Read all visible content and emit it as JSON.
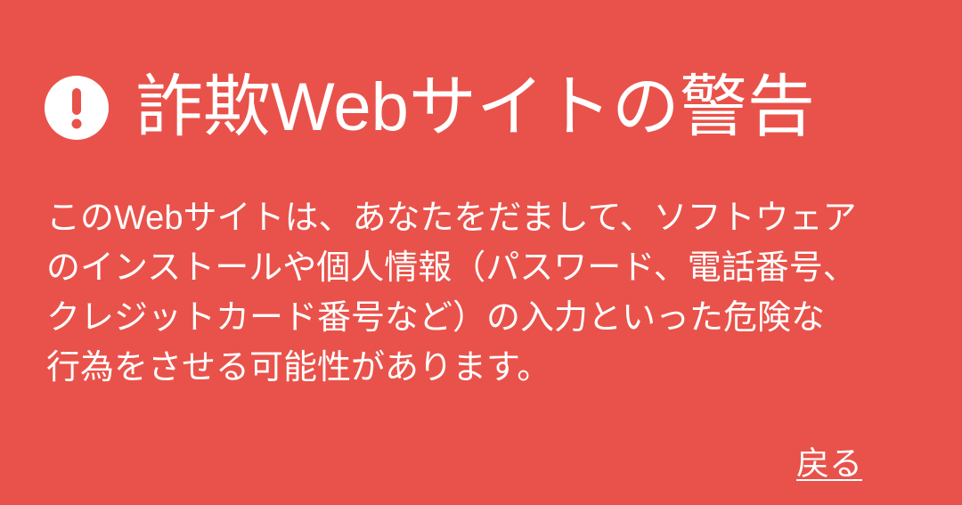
{
  "warning": {
    "icon": "exclamation-circle-icon",
    "title": "詐欺Webサイトの警告",
    "body": "このWebサイトは、あなたをだまして、ソフトウェアのインストールや個人情報（パスワード、電話番号、クレジットカード番号など）の入力といった危険な行為をさせる可能性があります。",
    "back_label": "戻る"
  },
  "colors": {
    "background": "#E9524A",
    "text": "#FFFFFF"
  }
}
